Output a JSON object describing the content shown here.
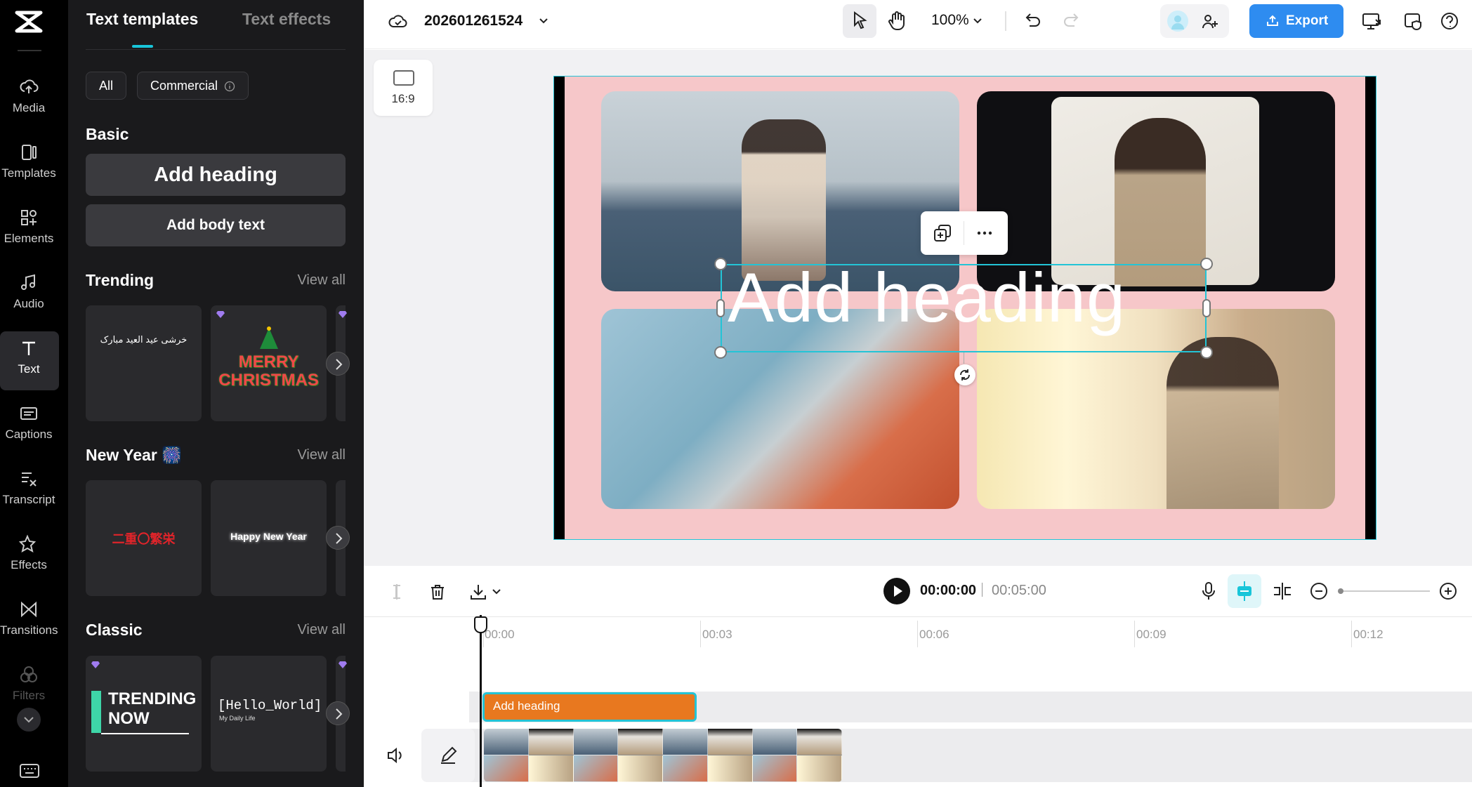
{
  "rail": {
    "items": [
      {
        "label": "Media",
        "icon": "cloud-upload-icon"
      },
      {
        "label": "Templates",
        "icon": "templates-icon"
      },
      {
        "label": "Elements",
        "icon": "elements-icon"
      },
      {
        "label": "Audio",
        "icon": "music-icon"
      },
      {
        "label": "Text",
        "icon": "text-icon",
        "active": true
      },
      {
        "label": "Captions",
        "icon": "captions-icon"
      },
      {
        "label": "Transcript",
        "icon": "transcript-icon"
      },
      {
        "label": "Effects",
        "icon": "effects-icon"
      },
      {
        "label": "Transitions",
        "icon": "transitions-icon"
      },
      {
        "label": "Filters",
        "icon": "filters-icon"
      }
    ]
  },
  "panel": {
    "tabs": [
      "Text templates",
      "Text effects"
    ],
    "chips": [
      "All",
      "Commercial"
    ],
    "basic": {
      "title": "Basic",
      "add_heading": "Add heading",
      "add_body": "Add body text"
    },
    "sections": [
      {
        "title": "Trending",
        "view_all": "View all",
        "cards": [
          "خرشی عید العید مبارک",
          "MERRY CHRISTMAS"
        ]
      },
      {
        "title": "New Year 🎆",
        "view_all": "View all",
        "cards": [
          "二重〇繁栄",
          "Happy New Year"
        ]
      },
      {
        "title": "Classic",
        "view_all": "View all",
        "cards": [
          "TRENDING NOW",
          "[Hello_World]",
          "My Daily Life"
        ]
      }
    ]
  },
  "topbar": {
    "project_name": "202601261524",
    "zoom": "100%",
    "export_label": "Export"
  },
  "canvas": {
    "ratio_label": "16:9",
    "heading_text": "Add heading"
  },
  "timeline": {
    "current_time": "00:00:00",
    "total_time": "00:05:00",
    "ticks": [
      "00:00",
      "00:03",
      "00:06",
      "00:09",
      "00:12"
    ],
    "text_clip_label": "Add heading"
  },
  "colors": {
    "accent": "#18c5d9",
    "export": "#2e8cf0",
    "clip_orange": "#e8781f",
    "canvas_bg": "#f6c7c9"
  }
}
